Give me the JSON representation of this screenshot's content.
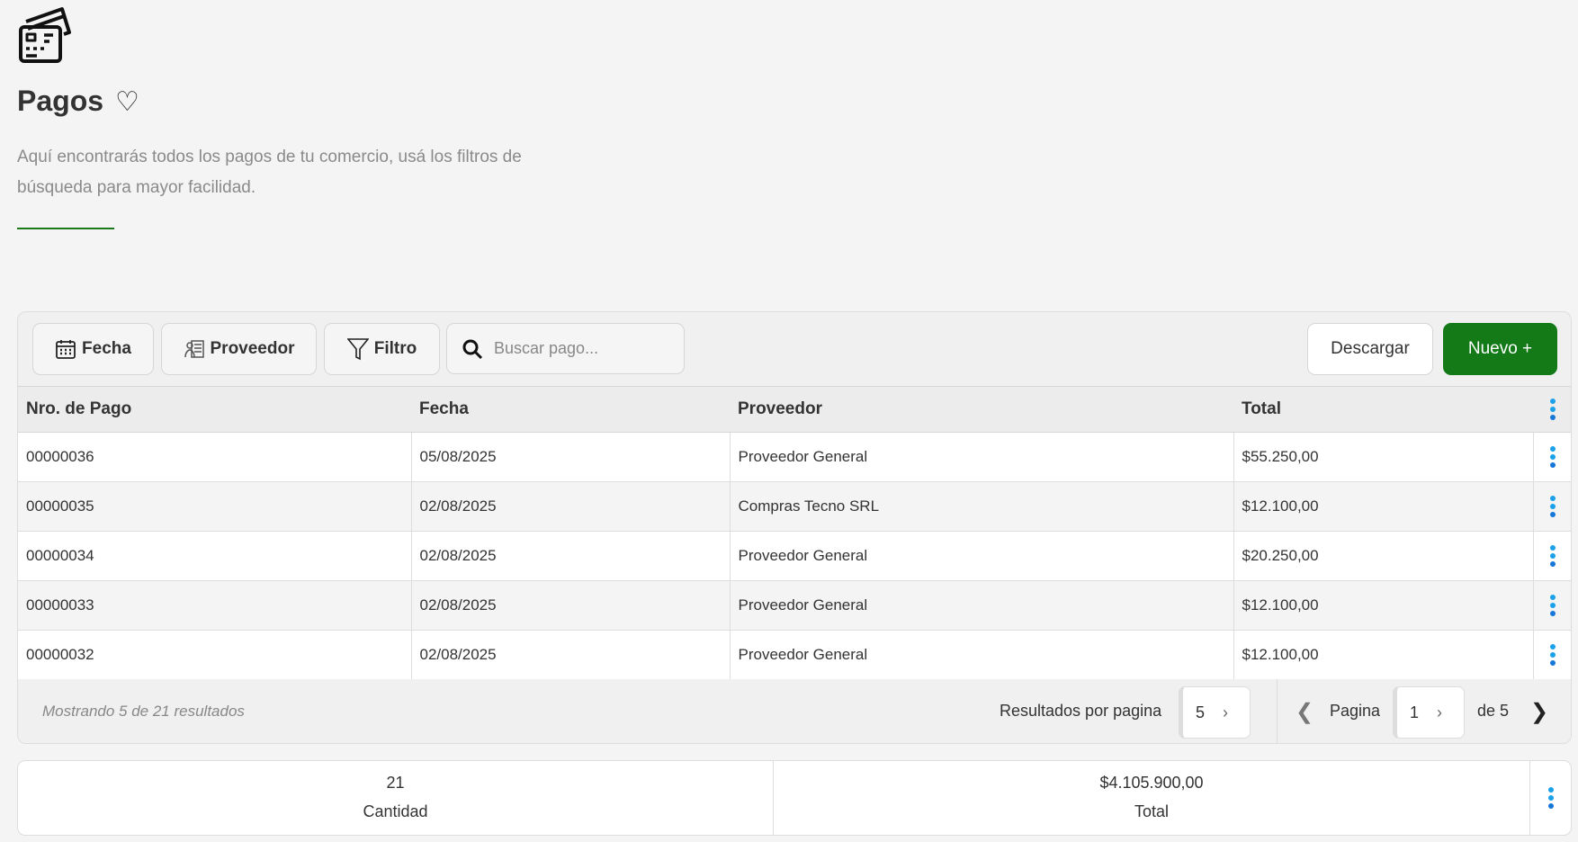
{
  "header": {
    "title": "Pagos",
    "description": "Aquí encontrarás todos los pagos de tu comercio, usá los filtros de búsqueda para mayor facilidad."
  },
  "toolbar": {
    "fecha": "Fecha",
    "proveedor": "Proveedor",
    "filtro": "Filtro",
    "search_placeholder": "Buscar pago...",
    "descargar": "Descargar",
    "nuevo": "Nuevo +"
  },
  "table": {
    "columns": [
      "Nro. de Pago",
      "Fecha",
      "Proveedor",
      "Total"
    ],
    "rows": [
      [
        "00000036",
        "05/08/2025",
        "Proveedor General",
        "$55.250,00"
      ],
      [
        "00000035",
        "02/08/2025",
        "Compras Tecno SRL",
        "$12.100,00"
      ],
      [
        "00000034",
        "02/08/2025",
        "Proveedor General",
        "$20.250,00"
      ],
      [
        "00000033",
        "02/08/2025",
        "Proveedor General",
        "$12.100,00"
      ],
      [
        "00000032",
        "02/08/2025",
        "Proveedor General",
        "$12.100,00"
      ]
    ]
  },
  "footer": {
    "showing": "Mostrando 5 de 21 resultados",
    "per_page_label": "Resultados por pagina",
    "per_page": "5",
    "page_label": "Pagina",
    "page": "1",
    "of_pages": "de 5"
  },
  "summary": {
    "count": "21",
    "count_label": "Cantidad",
    "total": "$4.105.900,00",
    "total_label": "Total"
  },
  "colors": {
    "accent": "#137a17",
    "kebab": "#1ba0ea"
  }
}
